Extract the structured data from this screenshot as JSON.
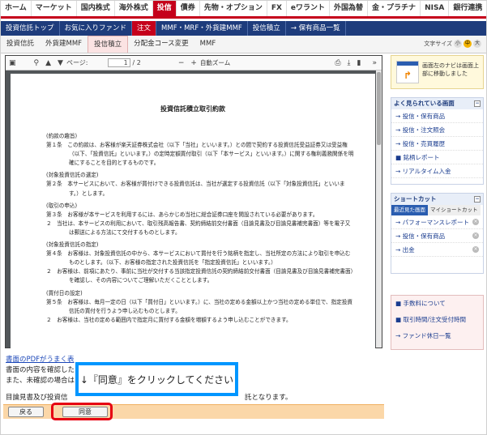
{
  "topnav": [
    "ホーム",
    "マーケット",
    "国内株式",
    "海外株式",
    "投信",
    "債券",
    "先物・オプション",
    "FX",
    "eワラント",
    "外国為替",
    "金・プラチナ",
    "NISA",
    "銀行連携"
  ],
  "subnav": [
    "投資信託トップ",
    "お気に入りファンド",
    "注文",
    "MMF・MRF・外貨建MMF",
    "投信積立",
    "→ 保有商品一覧"
  ],
  "tabs": [
    "投資信託",
    "外貨建MMF",
    "投信積立",
    "分配金コース変更",
    "MMF"
  ],
  "fontsize": {
    "label": "文字サイズ",
    "small": "小",
    "medium": "中",
    "large": "大"
  },
  "viewer": {
    "page_label": "ページ:",
    "page_current": "1",
    "page_total": "/ 2",
    "zoom": "自動ズーム",
    "doc_title": "投資信託積立取引約款",
    "lines": [
      {
        "t": "(約款の趣旨)",
        "h": true
      },
      {
        "t": "第１条　この約款は、お客様が楽天証券株式会社（以下「当社」といいます。）との間で契約する投資信託受益証券又は受益権（以下、「投資信託」といいます。）の定時定額買付取引（以下「本サービス」といいます。）に関する権利義務関係を明確にすることを目的とするものです。",
        "p": true
      },
      {
        "t": "(対象投資信託の選定)",
        "h": true
      },
      {
        "t": "第２条　本サービスにおいて、お客様が買付けできる投資信託は、当社が選定する投資信託（以下「対象投資信託」といいます。）とします。",
        "p": true
      },
      {
        "t": "(取引の申込)",
        "h": true
      },
      {
        "t": "第３条　お客様が本サービスを利用するには、あらかじめ当社に総合証券口座を開設されている必要があります。",
        "p": true
      },
      {
        "t": "２　当社は、本サービスの利用において、取引残高報告書、契約締結前交付書面（目論見書及び目論見書補完書面）等を電子又は郵送による方法にて交付するものとします。",
        "p": true
      },
      {
        "t": "(対象投資信託の指定)",
        "h": true
      },
      {
        "t": "第４条　お客様は、対象投資信託の中から、本サービスにおいて買付を行う銘柄を指定し、当社所定の方法により取引を申込むものとします。（以下、お客様の指定された投資信託を「指定投資信託」といいます。）",
        "p": true
      },
      {
        "t": "２　お客様は、前項にあたり、事前に当社が交付する当該指定投資信託の契約締結前交付書面（目論見書及び目論見書補完書面）を確認し、その内容についてご理解いただくこととします。",
        "p": true
      },
      {
        "t": "(買付日の設定)",
        "h": true
      },
      {
        "t": "第５条　お客様は、毎月一定の日（以下「買付日」といいます。）に、当社の定める金額以上かつ当社の定める単位で、指定投資信託の買付を行うよう申し込むものとします。",
        "p": true
      },
      {
        "t": "２　お客様は、当社の定める範囲内で指定月に買付する金額を増額するよう申し込むことができます。",
        "p": true
      }
    ]
  },
  "bottom": {
    "pdf_link": "書面のPDFがうまく表",
    "line1": "書面の内容を確認した",
    "line2": "また、未確認の場合は",
    "line3": "目論見書及び投資信",
    "line3_tail": "託となります。"
  },
  "callout": "↓『同意』をクリックしてください",
  "buttons": {
    "back": "戻る",
    "agree": "同意"
  },
  "sidebar": {
    "notice": "画面左のナビは画面上部に移動しました",
    "frequent": {
      "title": "よく見られている画面",
      "items": [
        "→ 投信・保有商品",
        "→ 投信・注文照会",
        "→ 投信・売買履歴",
        "■ 銘柄レポート",
        "→ リアルタイム入金"
      ]
    },
    "shortcut": {
      "title": "ショートカット",
      "tab_recent": "最近見た画面",
      "tab_my": "マイショートカット",
      "items": [
        "→ パフォーマンスレポート",
        "→ 投信・保有商品",
        "→ 出金"
      ]
    },
    "links": [
      "■ 手数料について",
      "■ 取引時間/注文受付時間",
      "→ ファンド休日一覧"
    ]
  }
}
